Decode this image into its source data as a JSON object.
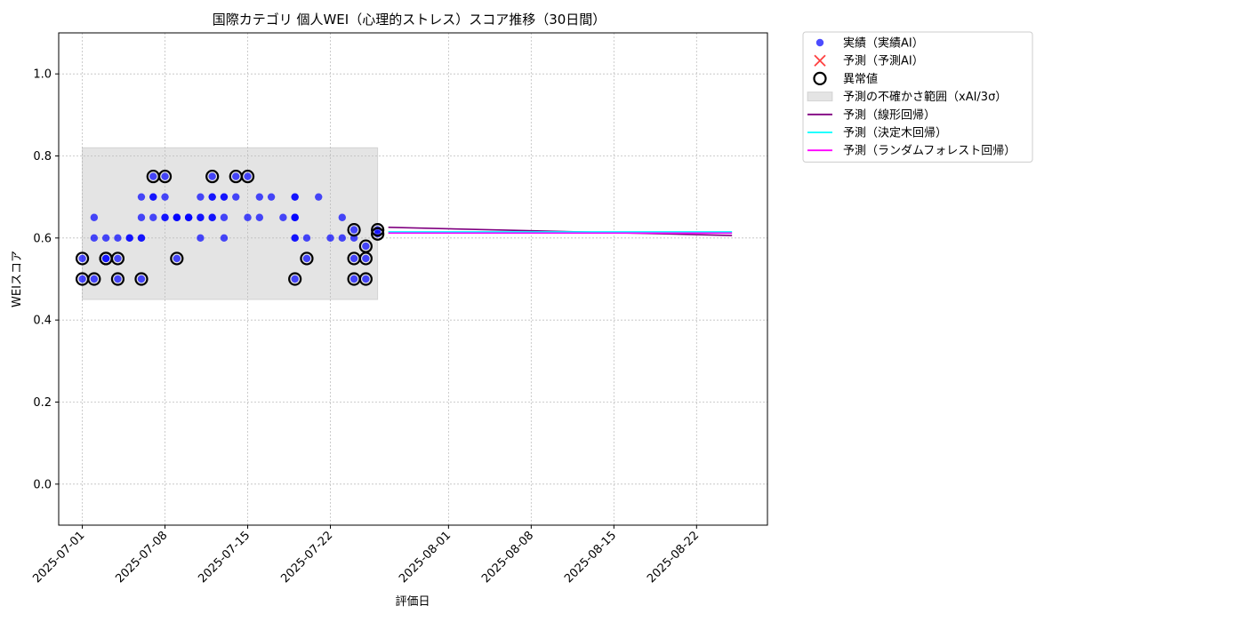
{
  "chart_data": {
    "type": "scatter",
    "title": "国際カテゴリ 個人WEI（心理的ストレス）スコア推移（30日間）",
    "xlabel": "評価日",
    "ylabel": "WEIスコア",
    "xlim": [
      "2025-06-29",
      "2025-08-28"
    ],
    "ylim": [
      -0.1,
      1.1
    ],
    "yticks": [
      0.0,
      0.2,
      0.4,
      0.6,
      0.8,
      1.0
    ],
    "xticks": [
      "2025-07-01",
      "2025-07-08",
      "2025-07-15",
      "2025-07-22",
      "2025-08-01",
      "2025-08-08",
      "2025-08-15",
      "2025-08-22"
    ],
    "grid": true,
    "legend_position": "outside-top-right",
    "legend": [
      {
        "label": "実績（実績AI）",
        "kind": "dot",
        "color": "#0000ff"
      },
      {
        "label": "予測（予測AI）",
        "kind": "x",
        "color": "#ff0000"
      },
      {
        "label": "異常値",
        "kind": "ring",
        "color": "#000000"
      },
      {
        "label": "予測の不確かさ範囲（xAI/3σ）",
        "kind": "band",
        "color": "#bbbbbb"
      },
      {
        "label": "予測（線形回帰）",
        "kind": "line",
        "color": "#800080"
      },
      {
        "label": "予測（決定木回帰）",
        "kind": "line",
        "color": "#00ffff"
      },
      {
        "label": "予測（ランダムフォレスト回帰）",
        "kind": "line",
        "color": "#ff00ff"
      }
    ],
    "uncertainty_band": {
      "x": [
        "2025-07-01",
        "2025-07-26"
      ],
      "y": [
        0.45,
        0.82
      ]
    },
    "actual": [
      [
        "2025-07-01",
        0.55
      ],
      [
        "2025-07-01",
        0.5
      ],
      [
        "2025-07-02",
        0.5
      ],
      [
        "2025-07-02",
        0.65
      ],
      [
        "2025-07-02",
        0.6
      ],
      [
        "2025-07-03",
        0.55
      ],
      [
        "2025-07-03",
        0.6
      ],
      [
        "2025-07-03",
        0.55
      ],
      [
        "2025-07-04",
        0.55
      ],
      [
        "2025-07-04",
        0.6
      ],
      [
        "2025-07-04",
        0.5
      ],
      [
        "2025-07-05",
        0.6
      ],
      [
        "2025-07-05",
        0.6
      ],
      [
        "2025-07-06",
        0.6
      ],
      [
        "2025-07-06",
        0.6
      ],
      [
        "2025-07-06",
        0.5
      ],
      [
        "2025-07-06",
        0.65
      ],
      [
        "2025-07-06",
        0.7
      ],
      [
        "2025-07-07",
        0.75
      ],
      [
        "2025-07-07",
        0.7
      ],
      [
        "2025-07-07",
        0.7
      ],
      [
        "2025-07-07",
        0.65
      ],
      [
        "2025-07-08",
        0.65
      ],
      [
        "2025-07-08",
        0.65
      ],
      [
        "2025-07-08",
        0.75
      ],
      [
        "2025-07-08",
        0.7
      ],
      [
        "2025-07-09",
        0.65
      ],
      [
        "2025-07-09",
        0.55
      ],
      [
        "2025-07-09",
        0.65
      ],
      [
        "2025-07-09",
        0.65
      ],
      [
        "2025-07-10",
        0.65
      ],
      [
        "2025-07-10",
        0.65
      ],
      [
        "2025-07-10",
        0.65
      ],
      [
        "2025-07-11",
        0.6
      ],
      [
        "2025-07-11",
        0.65
      ],
      [
        "2025-07-11",
        0.65
      ],
      [
        "2025-07-11",
        0.7
      ],
      [
        "2025-07-12",
        0.75
      ],
      [
        "2025-07-12",
        0.7
      ],
      [
        "2025-07-12",
        0.65
      ],
      [
        "2025-07-12",
        0.65
      ],
      [
        "2025-07-12",
        0.7
      ],
      [
        "2025-07-13",
        0.7
      ],
      [
        "2025-07-13",
        0.7
      ],
      [
        "2025-07-13",
        0.65
      ],
      [
        "2025-07-13",
        0.6
      ],
      [
        "2025-07-14",
        0.75
      ],
      [
        "2025-07-14",
        0.7
      ],
      [
        "2025-07-15",
        0.75
      ],
      [
        "2025-07-15",
        0.65
      ],
      [
        "2025-07-16",
        0.7
      ],
      [
        "2025-07-16",
        0.65
      ],
      [
        "2025-07-17",
        0.7
      ],
      [
        "2025-07-18",
        0.65
      ],
      [
        "2025-07-19",
        0.5
      ],
      [
        "2025-07-19",
        0.65
      ],
      [
        "2025-07-19",
        0.6
      ],
      [
        "2025-07-19",
        0.7
      ],
      [
        "2025-07-19",
        0.7
      ],
      [
        "2025-07-19",
        0.65
      ],
      [
        "2025-07-19",
        0.6
      ],
      [
        "2025-07-19",
        0.65
      ],
      [
        "2025-07-20",
        0.55
      ],
      [
        "2025-07-20",
        0.6
      ],
      [
        "2025-07-21",
        0.7
      ],
      [
        "2025-07-22",
        0.6
      ],
      [
        "2025-07-23",
        0.65
      ],
      [
        "2025-07-23",
        0.6
      ],
      [
        "2025-07-24",
        0.55
      ],
      [
        "2025-07-24",
        0.6
      ],
      [
        "2025-07-24",
        0.62
      ],
      [
        "2025-07-24",
        0.5
      ],
      [
        "2025-07-25",
        0.5
      ],
      [
        "2025-07-25",
        0.55
      ],
      [
        "2025-07-25",
        0.58
      ],
      [
        "2025-07-26",
        0.62
      ],
      [
        "2025-07-26",
        0.61
      ]
    ],
    "anomalies": [
      [
        "2025-07-01",
        0.55
      ],
      [
        "2025-07-01",
        0.5
      ],
      [
        "2025-07-02",
        0.5
      ],
      [
        "2025-07-03",
        0.55
      ],
      [
        "2025-07-03",
        0.55
      ],
      [
        "2025-07-04",
        0.55
      ],
      [
        "2025-07-04",
        0.5
      ],
      [
        "2025-07-06",
        0.5
      ],
      [
        "2025-07-07",
        0.75
      ],
      [
        "2025-07-08",
        0.75
      ],
      [
        "2025-07-09",
        0.55
      ],
      [
        "2025-07-12",
        0.75
      ],
      [
        "2025-07-14",
        0.75
      ],
      [
        "2025-07-15",
        0.75
      ],
      [
        "2025-07-19",
        0.5
      ],
      [
        "2025-07-20",
        0.55
      ],
      [
        "2025-07-24",
        0.55
      ],
      [
        "2025-07-24",
        0.62
      ],
      [
        "2025-07-24",
        0.5
      ],
      [
        "2025-07-25",
        0.5
      ],
      [
        "2025-07-25",
        0.55
      ],
      [
        "2025-07-25",
        0.58
      ],
      [
        "2025-07-26",
        0.62
      ],
      [
        "2025-07-26",
        0.61
      ]
    ],
    "forecast_lines": [
      {
        "name": "予測（線形回帰）",
        "color": "#800080",
        "x": [
          "2025-07-26",
          "2025-08-25"
        ],
        "y": [
          0.626,
          0.606
        ]
      },
      {
        "name": "予測（決定木回帰）",
        "color": "#00ffff",
        "x": [
          "2025-07-26",
          "2025-08-25"
        ],
        "y": [
          0.615,
          0.615
        ]
      },
      {
        "name": "予測（ランダムフォレスト回帰）",
        "color": "#ff00ff",
        "x": [
          "2025-07-26",
          "2025-08-25"
        ],
        "y": [
          0.612,
          0.612
        ]
      }
    ]
  }
}
